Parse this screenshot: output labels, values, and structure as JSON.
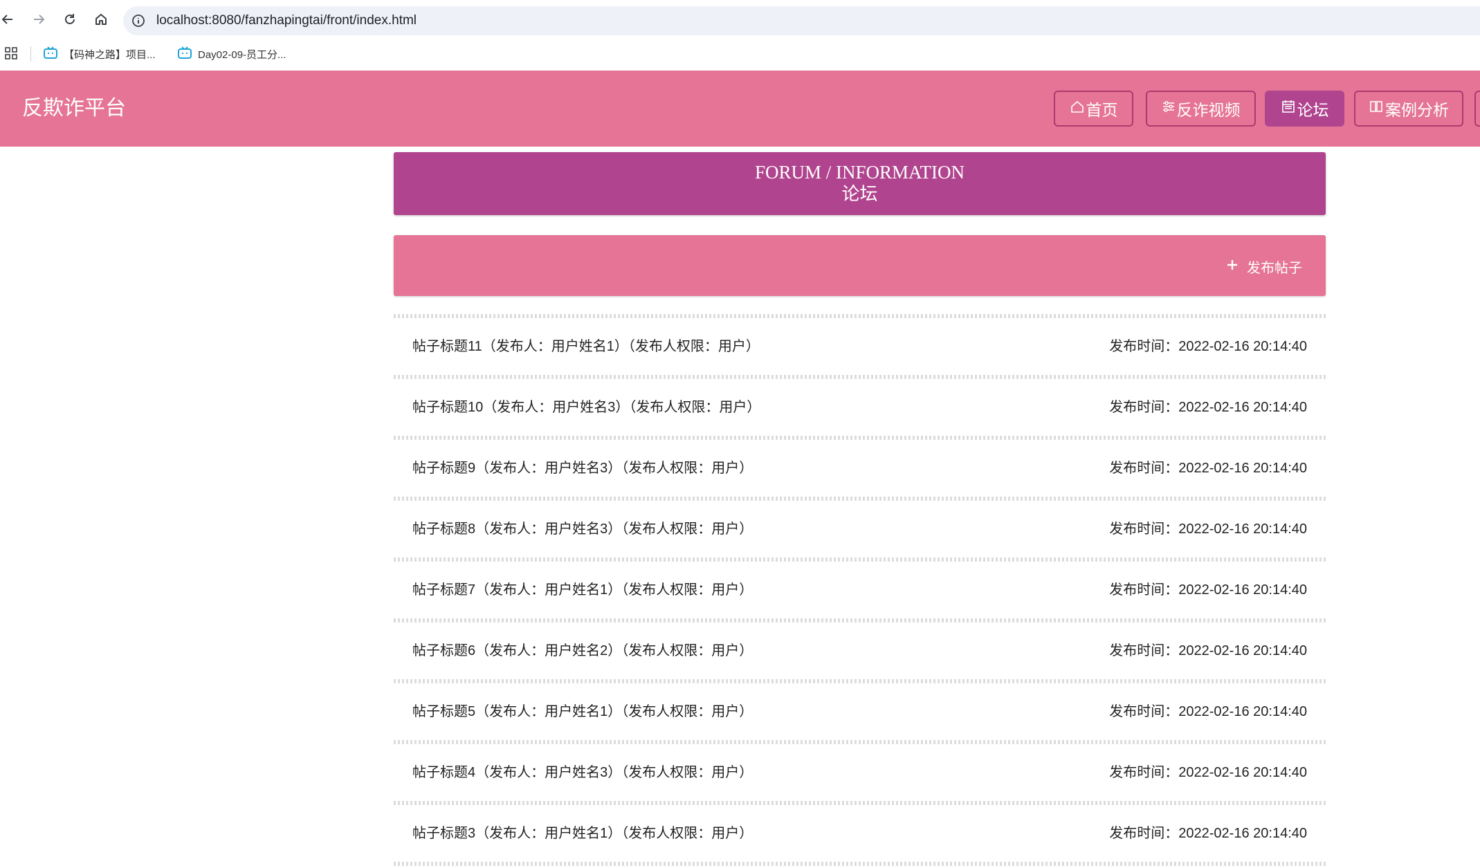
{
  "browser": {
    "url": "localhost:8080/fanzhapingtai/front/index.html",
    "bookmarks": [
      {
        "label": "【码神之路】项目..."
      },
      {
        "label": "Day02-09-员工分..."
      }
    ]
  },
  "header": {
    "site_title": "反欺诈平台",
    "nav": [
      {
        "label": "首页",
        "icon": "home-icon",
        "active": false
      },
      {
        "label": "反诈视频",
        "icon": "sliders-icon",
        "active": false
      },
      {
        "label": "论坛",
        "icon": "calendar-icon",
        "active": true
      },
      {
        "label": "案例分析",
        "icon": "grid-icon",
        "active": false
      }
    ]
  },
  "banner": {
    "title_en": "FORUM / INFORMATION",
    "title_cn": "论坛"
  },
  "actions": {
    "publish_label": "发布帖子"
  },
  "posts": [
    {
      "title": "帖子标题11（发布人：用户姓名1）（发布人权限：用户）",
      "time": "发布时间：2022-02-16 20:14:40"
    },
    {
      "title": "帖子标题10（发布人：用户姓名3）（发布人权限：用户）",
      "time": "发布时间：2022-02-16 20:14:40"
    },
    {
      "title": "帖子标题9（发布人：用户姓名3）（发布人权限：用户）",
      "time": "发布时间：2022-02-16 20:14:40"
    },
    {
      "title": "帖子标题8（发布人：用户姓名3）（发布人权限：用户）",
      "time": "发布时间：2022-02-16 20:14:40"
    },
    {
      "title": "帖子标题7（发布人：用户姓名1）（发布人权限：用户）",
      "time": "发布时间：2022-02-16 20:14:40"
    },
    {
      "title": "帖子标题6（发布人：用户姓名2）（发布人权限：用户）",
      "time": "发布时间：2022-02-16 20:14:40"
    },
    {
      "title": "帖子标题5（发布人：用户姓名1）（发布人权限：用户）",
      "time": "发布时间：2022-02-16 20:14:40"
    },
    {
      "title": "帖子标题4（发布人：用户姓名3）（发布人权限：用户）",
      "time": "发布时间：2022-02-16 20:14:40"
    },
    {
      "title": "帖子标题3（发布人：用户姓名1）（发布人权限：用户）",
      "time": "发布时间：2022-02-16 20:14:40"
    }
  ],
  "colors": {
    "header_bg": "#e57496",
    "banner_bg": "#b0448e",
    "nav_border": "#b0396e",
    "nav_active_bg": "#b0448e"
  }
}
